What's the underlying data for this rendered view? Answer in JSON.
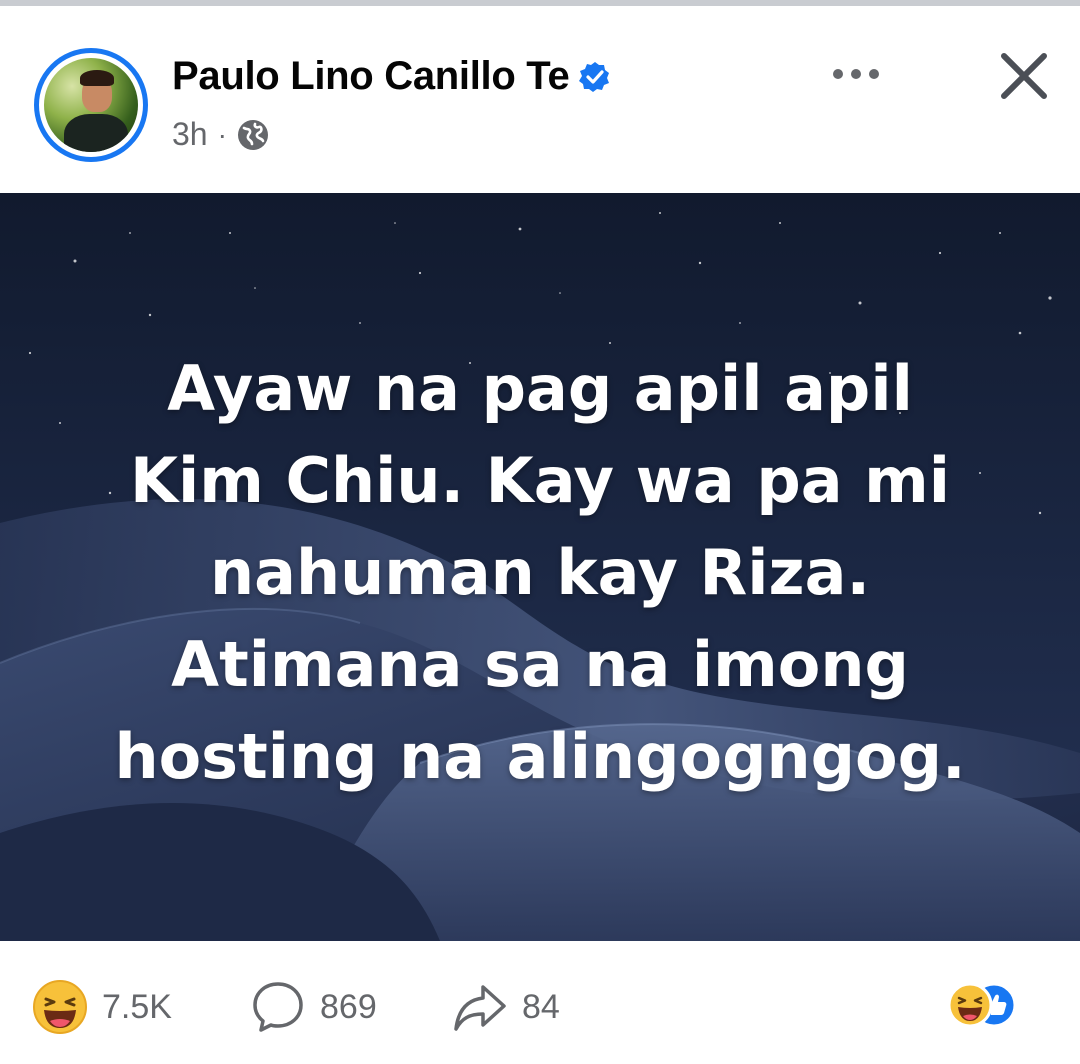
{
  "post": {
    "author": "Paulo Lino Canillo Te",
    "time": "3h",
    "separator": "·",
    "icons": {
      "verified": "verified-badge-icon",
      "audience": "globe-icon",
      "more": "more-options-icon",
      "close": "close-icon"
    },
    "text_lines": [
      "Ayaw na pag apil apil",
      "Kim Chiu. Kay wa pa mi",
      "nahuman kay Riza.",
      "Atimana sa na imong",
      "hosting na alingogngog."
    ]
  },
  "stats": {
    "reactions_count": "7.5K",
    "comments_count": "869",
    "shares_count": "84"
  },
  "colors": {
    "brand_blue": "#1877f2",
    "secondary_text": "#65676b",
    "post_background": "#1a2540"
  }
}
